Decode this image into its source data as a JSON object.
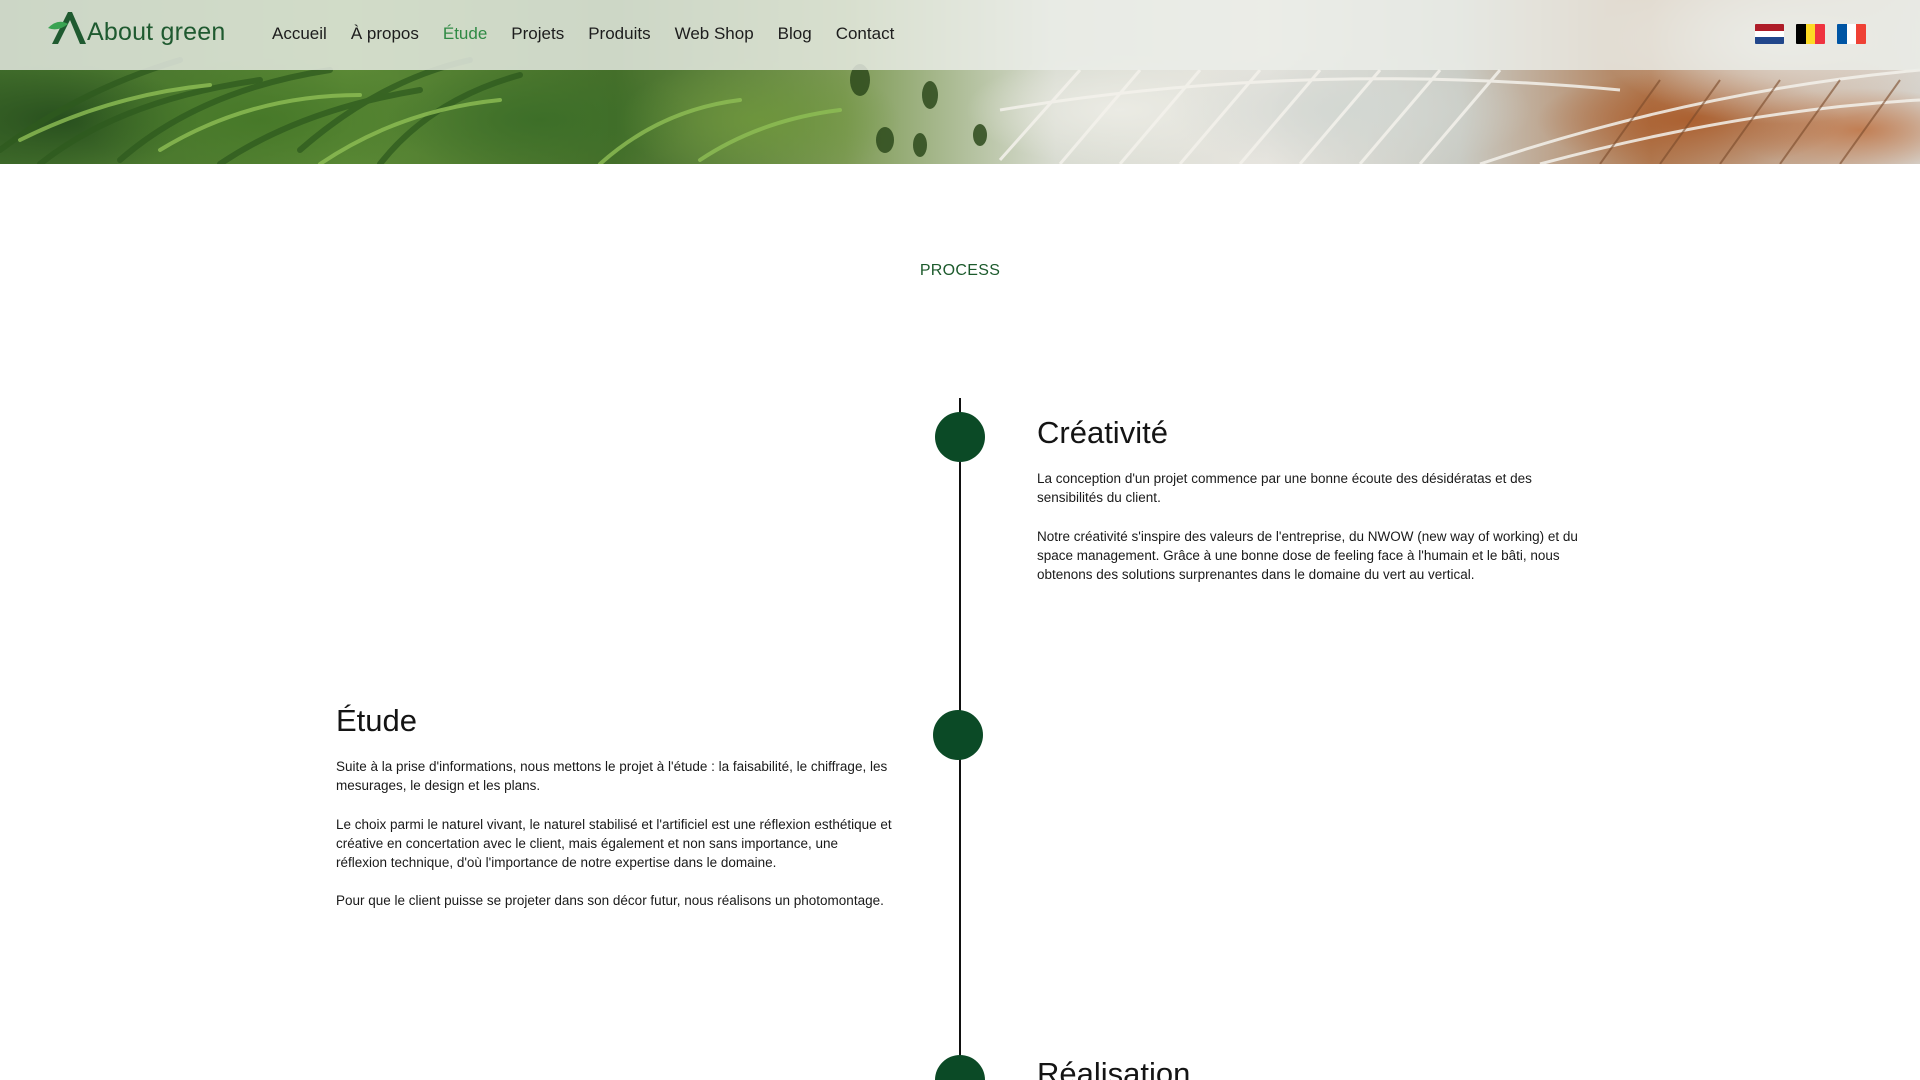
{
  "brand": {
    "name": "About green",
    "accent": "#0b4a26",
    "nav_active_color": "#2f8a44"
  },
  "nav": {
    "items": [
      {
        "label": "Accueil",
        "active": false
      },
      {
        "label": "À propos",
        "active": false
      },
      {
        "label": "Étude",
        "active": true
      },
      {
        "label": "Projets",
        "active": false
      },
      {
        "label": "Produits",
        "active": false
      },
      {
        "label": "Web Shop",
        "active": false
      },
      {
        "label": "Blog",
        "active": false
      },
      {
        "label": "Contact",
        "active": false
      }
    ],
    "languages": [
      {
        "icon": "flag-netherlands-icon"
      },
      {
        "icon": "flag-belgium-icon"
      },
      {
        "icon": "flag-france-icon"
      }
    ]
  },
  "section": {
    "eyebrow": "PROCESS"
  },
  "steps": [
    {
      "title": "Créativité",
      "paragraphs": [
        "La conception d'un projet commence par une bonne écoute des désidératas et des sensibilités du client.",
        "Notre créativité s'inspire des valeurs de l'entreprise, du NWOW (new way of working) et du space management. Grâce à une bonne dose de feeling face à l'humain et le bâti, nous obtenons des solutions surprenantes dans le domaine du vert au vertical."
      ]
    },
    {
      "title": "Étude",
      "paragraphs": [
        "Suite à la prise d'informations, nous mettons le projet à l'étude : la faisabilité, le chiffrage, les mesurages, le design et les plans.",
        "Le choix parmi le naturel vivant, le naturel stabilisé et l'artificiel est une réflexion esthétique et créative en concertation avec le client, mais également et non sans importance, une réflexion technique, d'où l'importance de notre expertise dans le domaine.",
        "Pour que le client puisse se projeter dans son décor futur, nous réalisons un photomontage."
      ]
    },
    {
      "title": "Réalisation",
      "paragraphs": []
    }
  ]
}
